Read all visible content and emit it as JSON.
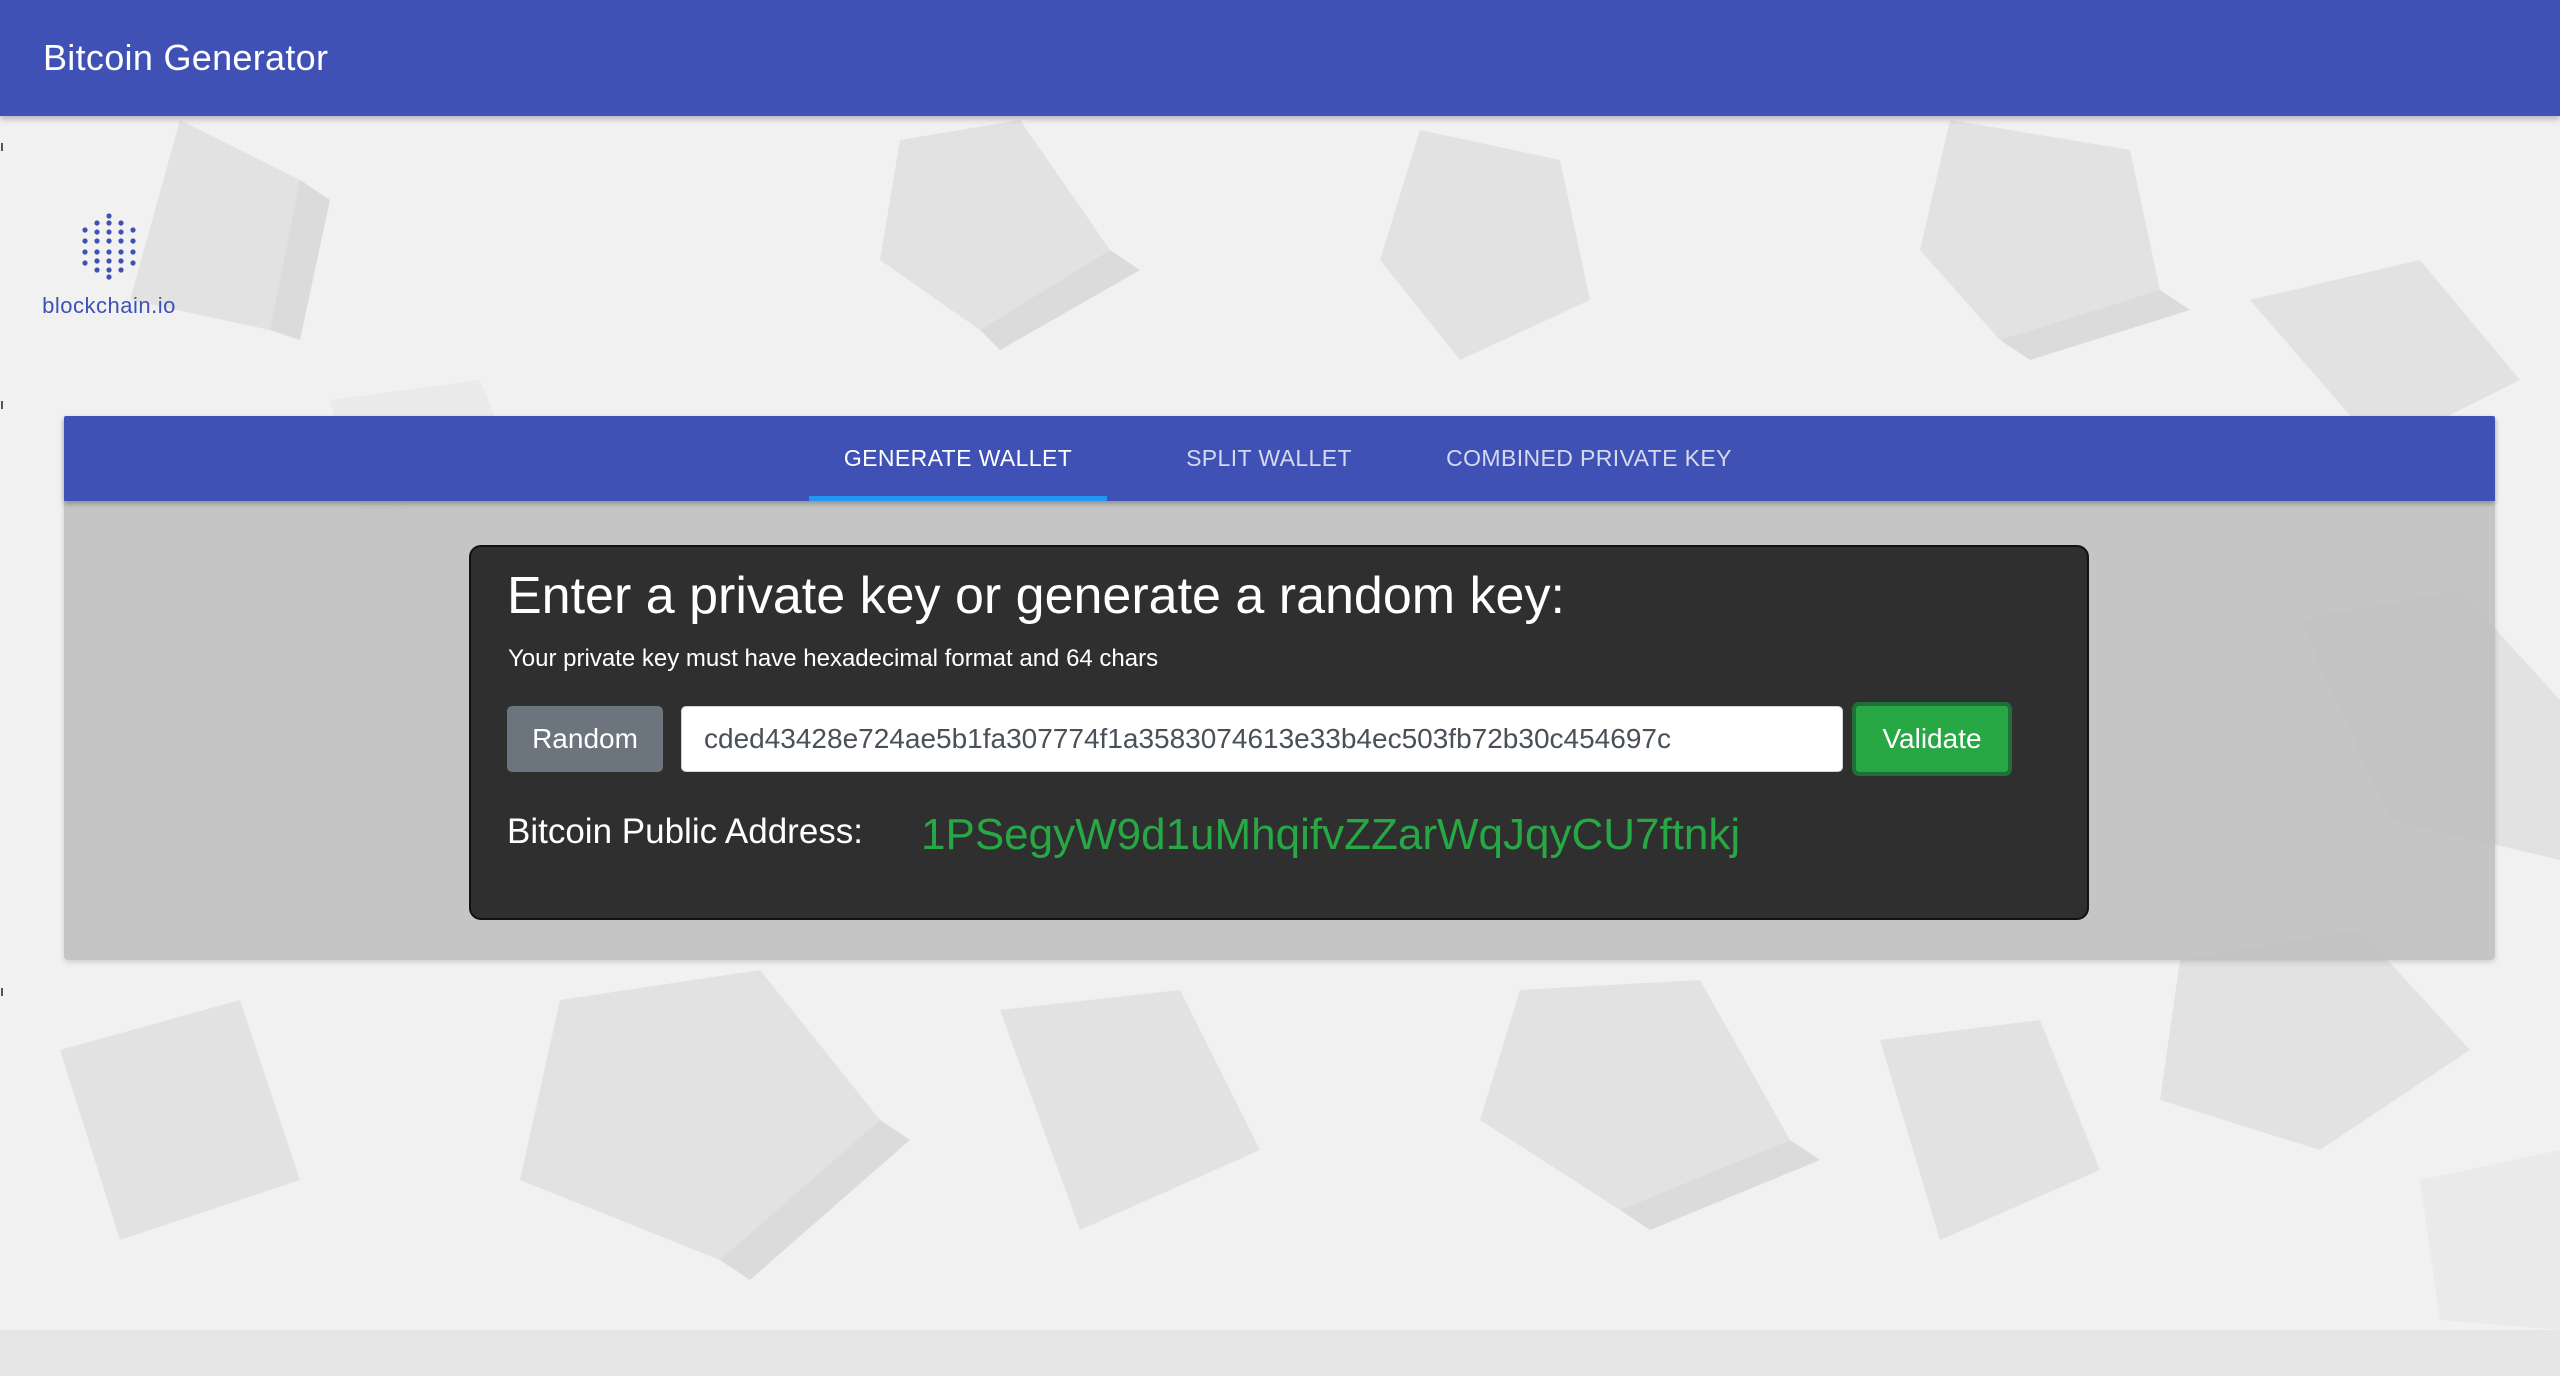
{
  "app_bar": {
    "title": "Bitcoin Generator"
  },
  "logo": {
    "text": "blockchain.io"
  },
  "tabs": [
    {
      "label": "GENERATE WALLET",
      "active": true
    },
    {
      "label": "SPLIT WALLET",
      "active": false
    },
    {
      "label": "COMBINED PRIVATE KEY",
      "active": false
    }
  ],
  "generator": {
    "heading": "Enter a private key or generate a random key:",
    "hint": "Your private key must have hexadecimal format and 64 chars",
    "random_label": "Random",
    "private_key_value": "cded43428e724ae5b1fa307774f1a3583074613e33b4ec503fb72b30c454697c",
    "validate_label": "Validate",
    "public_address_label": "Bitcoin Public Address:",
    "public_address_value": "1PSegyW9d1uMhqifvZZarWqJqyCU7ftnkj"
  },
  "colors": {
    "primary": "#3f51b5",
    "tab_indicator": "#2196f3",
    "success": "#28a745",
    "secondary": "#6c757d",
    "panel": "#2f2f2f"
  },
  "icons": {
    "logo": "blockchain-dots-logo-icon"
  }
}
